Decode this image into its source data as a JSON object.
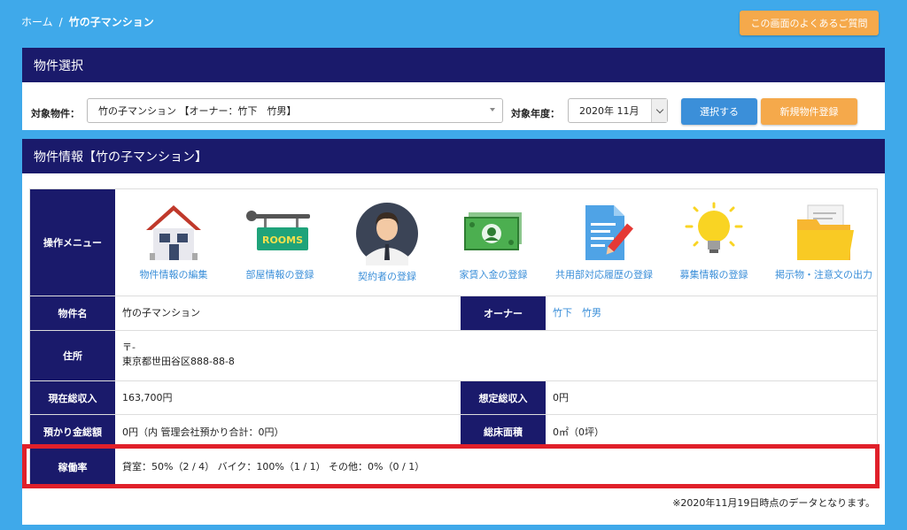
{
  "breadcrumb": {
    "home": "ホーム",
    "sep": "/",
    "current": "竹の子マンション"
  },
  "faq_button": "この画面のよくあるご質問",
  "property_select": {
    "title": "物件選択",
    "property_label": "対象物件：",
    "property_value": "竹の子マンション 【オーナー：竹下　竹男】",
    "year_label": "対象年度：",
    "year_value": "2020年 11月",
    "select_button": "選択する",
    "new_button": "新規物件登録"
  },
  "property_info": {
    "title": "物件情報【竹の子マンション】",
    "menu_header": "操作メニュー",
    "menu": [
      {
        "label": "物件情報の編集",
        "icon": "house-icon"
      },
      {
        "label": "部屋情報の登録",
        "icon": "rooms-sign-icon"
      },
      {
        "label": "契約者の登録",
        "icon": "person-icon"
      },
      {
        "label": "家賃入金の登録",
        "icon": "money-icon"
      },
      {
        "label": "共用部対応履歴の登録",
        "icon": "document-pen-icon"
      },
      {
        "label": "募集情報の登録",
        "icon": "lightbulb-icon"
      },
      {
        "label": "掲示物・注意文の出力",
        "icon": "folder-icon"
      }
    ],
    "rooms_sign_text": "ROOMS",
    "fields": {
      "name_label": "物件名",
      "name_value": "竹の子マンション",
      "owner_label": "オーナー",
      "owner_value": "竹下　竹男",
      "address_label": "住所",
      "address_zip": "〒-",
      "address_value": "東京都世田谷区888-88-8",
      "income_label": "現在総収入",
      "income_value": "163,700円",
      "expected_label": "想定総収入",
      "expected_value": "0円",
      "deposit_label": "預かり金総額",
      "deposit_value": "0円（内 管理会社預かり合計：0円）",
      "floor_label": "総床面積",
      "floor_value": "0㎡（0坪）",
      "occupancy_label": "稼働率",
      "occupancy_value": "貸室：50%（2 / 4） バイク：100%（1 / 1） その他：0%（0 / 1）"
    },
    "note": "※2020年11月19日時点のデータとなります。"
  },
  "colors": {
    "background": "#3fa9ea",
    "navy": "#1a1a6b",
    "orange": "#f5a94b",
    "blue": "#3b8fd9",
    "highlight": "#e0202a"
  }
}
